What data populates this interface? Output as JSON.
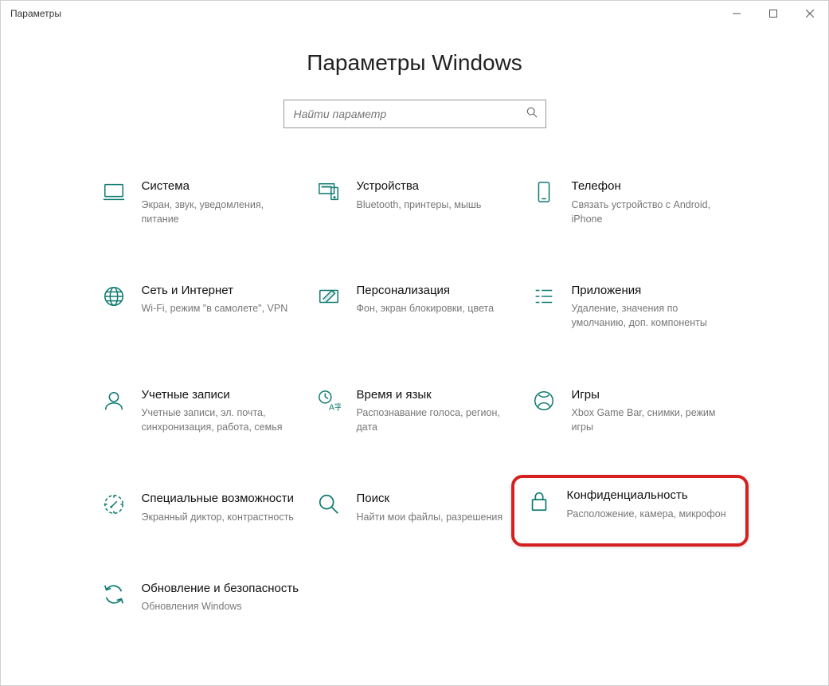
{
  "window": {
    "title": "Параметры"
  },
  "page": {
    "heading": "Параметры Windows"
  },
  "search": {
    "placeholder": "Найти параметр"
  },
  "tiles": {
    "system": {
      "title": "Система",
      "desc": "Экран, звук, уведомления, питание"
    },
    "devices": {
      "title": "Устройства",
      "desc": "Bluetooth, принтеры, мышь"
    },
    "phone": {
      "title": "Телефон",
      "desc": "Связать устройство с Android, iPhone"
    },
    "network": {
      "title": "Сеть и Интернет",
      "desc": "Wi-Fi, режим \"в самолете\", VPN"
    },
    "personal": {
      "title": "Персонализация",
      "desc": "Фон, экран блокировки, цвета"
    },
    "apps": {
      "title": "Приложения",
      "desc": "Удаление, значения по умолчанию, доп. компоненты"
    },
    "accounts": {
      "title": "Учетные записи",
      "desc": "Учетные записи, эл. почта, синхронизация, работа, семья"
    },
    "time": {
      "title": "Время и язык",
      "desc": "Распознавание голоса, регион, дата"
    },
    "gaming": {
      "title": "Игры",
      "desc": "Xbox Game Bar, снимки, режим игры"
    },
    "ease": {
      "title": "Специальные возможности",
      "desc": "Экранный диктор, контрастность"
    },
    "search_cat": {
      "title": "Поиск",
      "desc": "Найти мои файлы, разрешения"
    },
    "privacy": {
      "title": "Конфиденциальность",
      "desc": "Расположение, камера, микрофон"
    },
    "update": {
      "title": "Обновление и безопасность",
      "desc": "Обновления Windows"
    }
  }
}
